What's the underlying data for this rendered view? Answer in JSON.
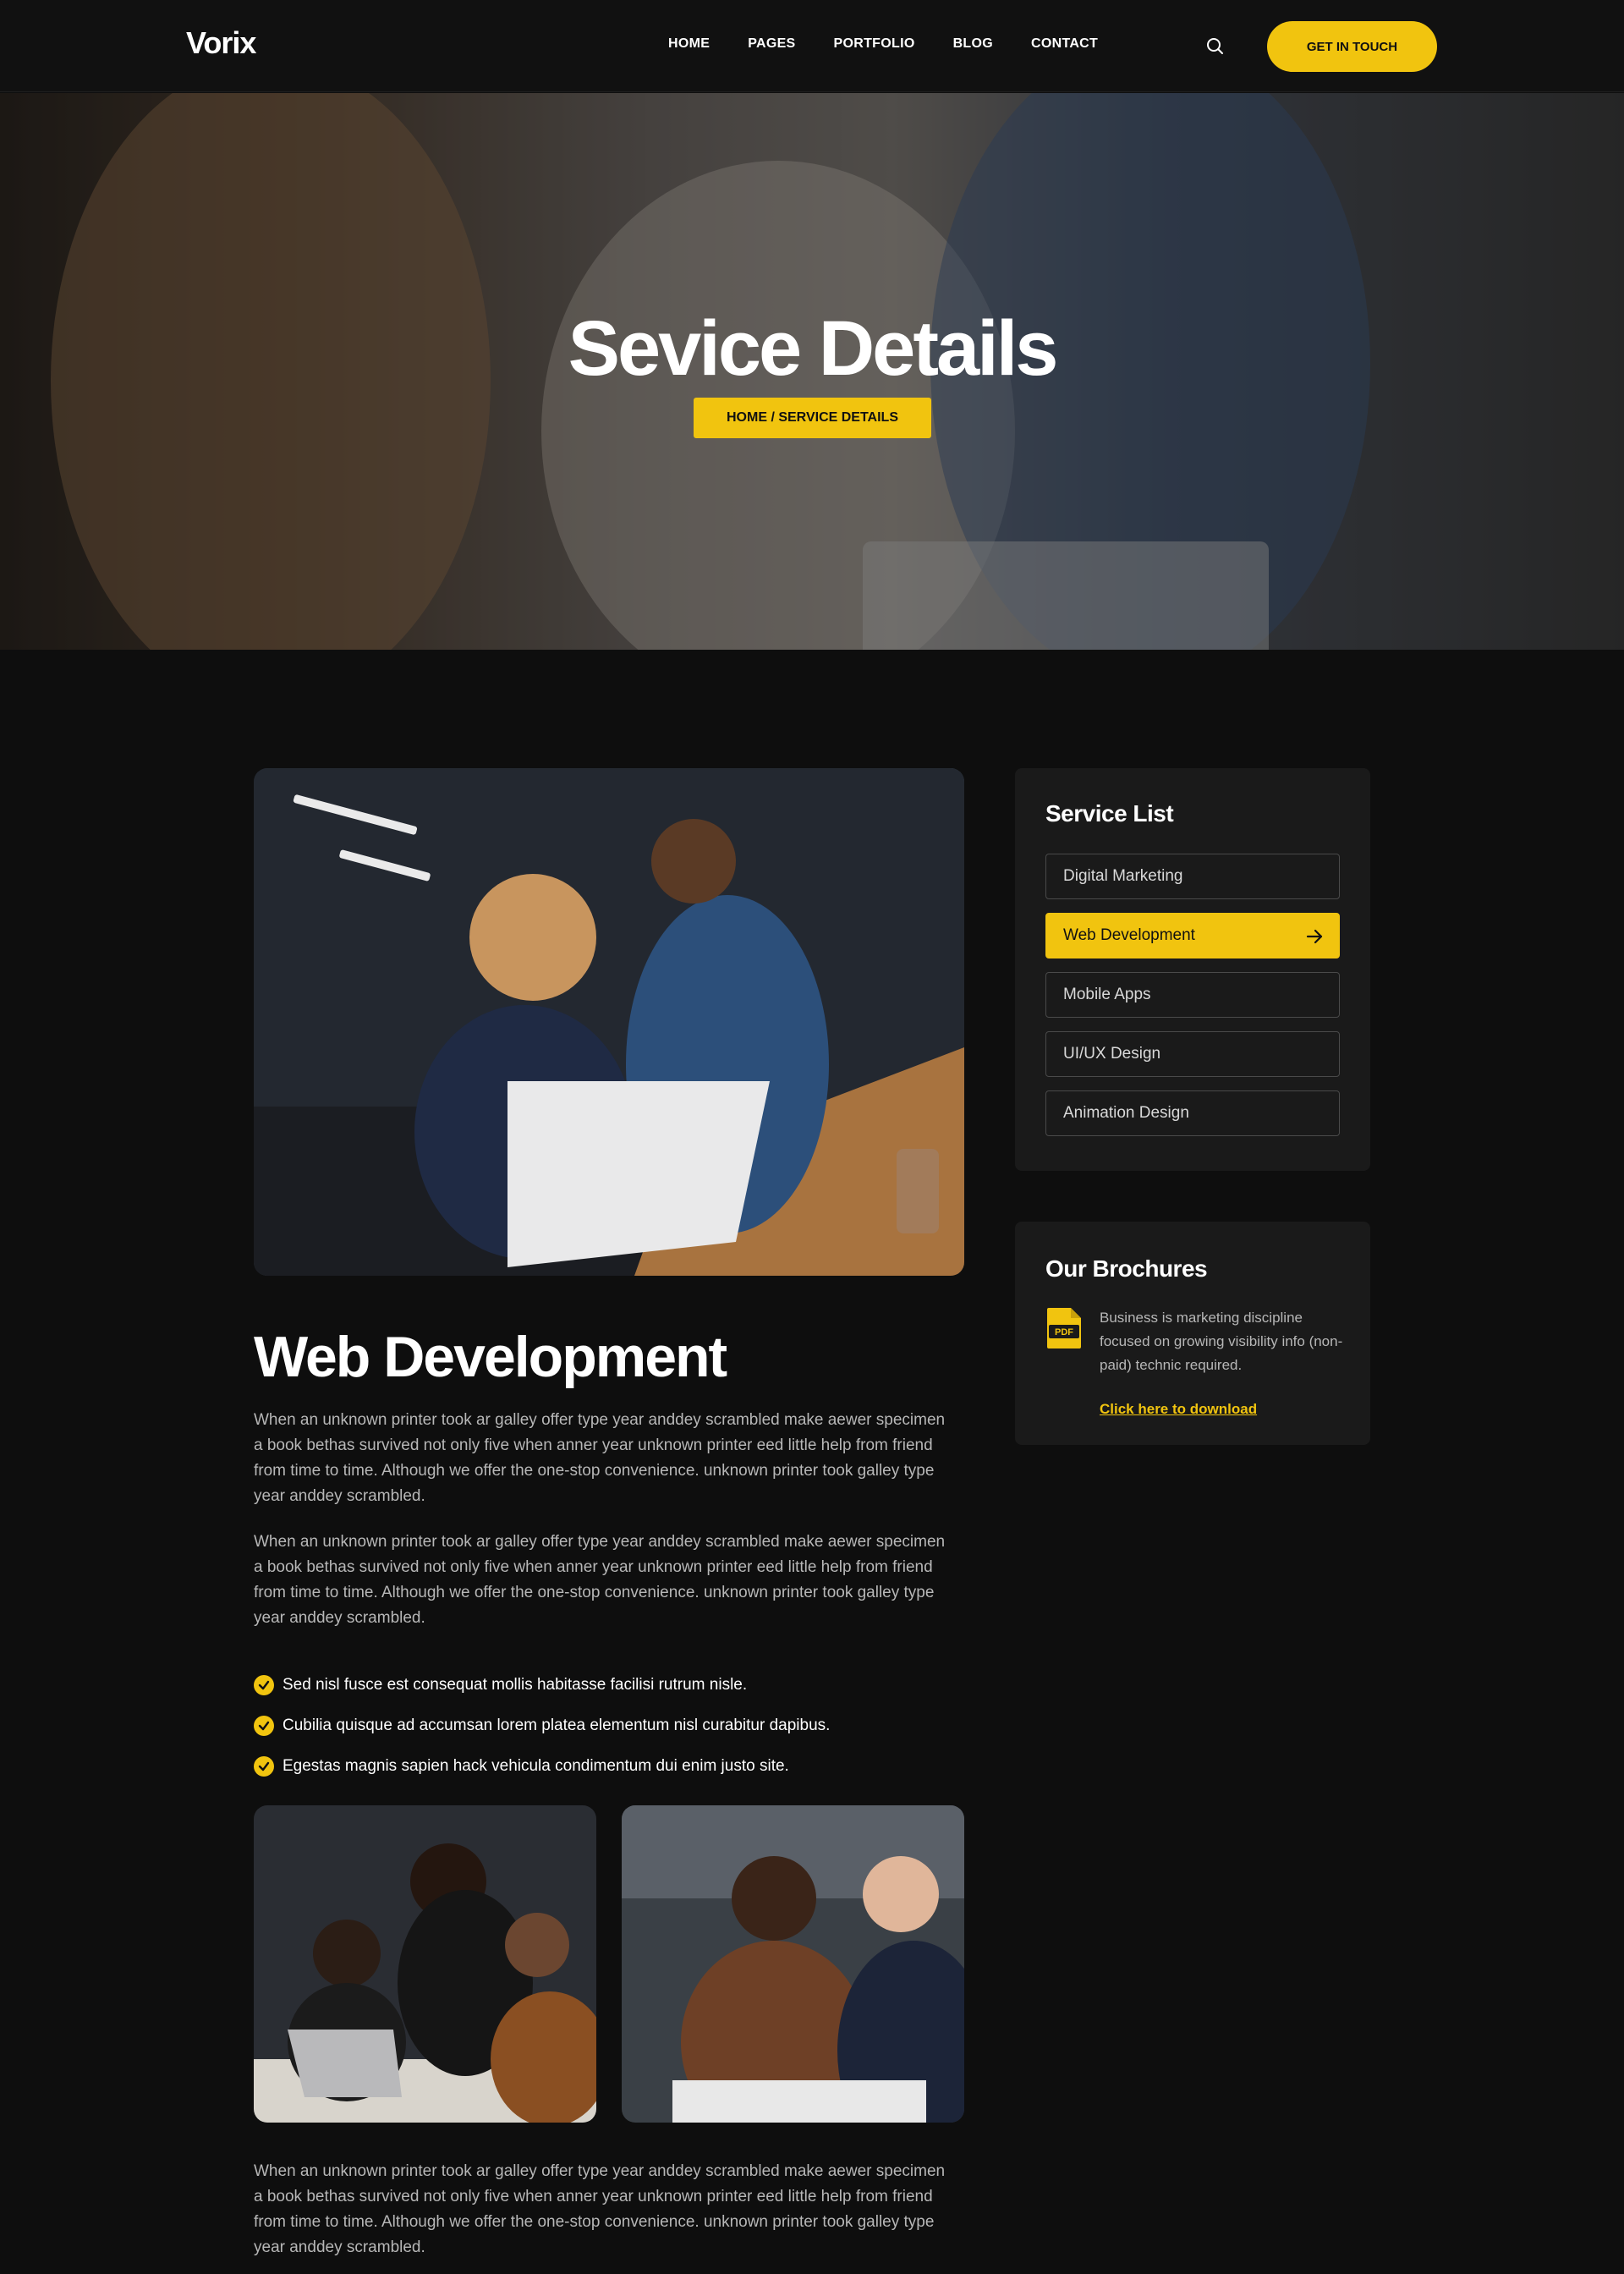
{
  "header": {
    "logo": "Vorix",
    "nav": [
      "HOME",
      "PAGES",
      "PORTFOLIO",
      "BLOG",
      "CONTACT"
    ],
    "cta_label": "GET IN TOUCH"
  },
  "hero": {
    "title": "Sevice Details",
    "breadcrumb": "HOME / SERVICE DETAILS"
  },
  "main": {
    "title": "Web Development",
    "paragraphs": [
      "When an unknown printer took ar galley offer type year anddey scrambled make aewer specimen  a book bethas survived not only five when anner year unknown printer eed  little help from friend from time to time. Although we offer the one-stop convenience. unknown printer took galley type year anddey scrambled.",
      "When an unknown printer took ar galley offer type year anddey scrambled make aewer specimen  a book bethas survived not only five when anner year unknown printer eed  little help from friend from time to time. Although we offer the one-stop convenience. unknown printer took galley type year anddey scrambled.",
      "When an unknown printer took ar galley offer type year anddey scrambled make aewer specimen  a book bethas survived not only five when anner year unknown printer eed  little help from friend from time to time. Although we offer the one-stop convenience. unknown printer took galley type year anddey scrambled."
    ],
    "checklist": [
      "Sed nisl fusce est consequat mollis habitasse facilisi rutrum nisle.",
      "Cubilia quisque ad accumsan lorem platea elementum nisl curabitur dapibus.",
      "Egestas magnis sapien hack vehicula condimentum dui enim justo site."
    ]
  },
  "sidebar": {
    "service_list_title": "Service List",
    "services": [
      {
        "label": "Digital Marketing",
        "active": false
      },
      {
        "label": "Web Development",
        "active": true
      },
      {
        "label": "Mobile Apps",
        "active": false
      },
      {
        "label": "UI/UX Design",
        "active": false
      },
      {
        "label": "Animation Design",
        "active": false
      }
    ],
    "brochure_title": "Our Brochures",
    "brochure_text": "Business is marketing discipline focused on growing visibility info (non-paid) technic required.",
    "brochure_link": "Click here to download",
    "pdf_label": "PDF"
  },
  "colors": {
    "accent": "#f1c40f",
    "background": "#0e0e0e",
    "card": "#1a1a1a",
    "muted_text": "#b7b7b7"
  },
  "icons": {
    "search": "search-icon",
    "arrow": "arrow-right-icon",
    "check": "check-circle-icon",
    "pdf": "pdf-file-icon"
  }
}
